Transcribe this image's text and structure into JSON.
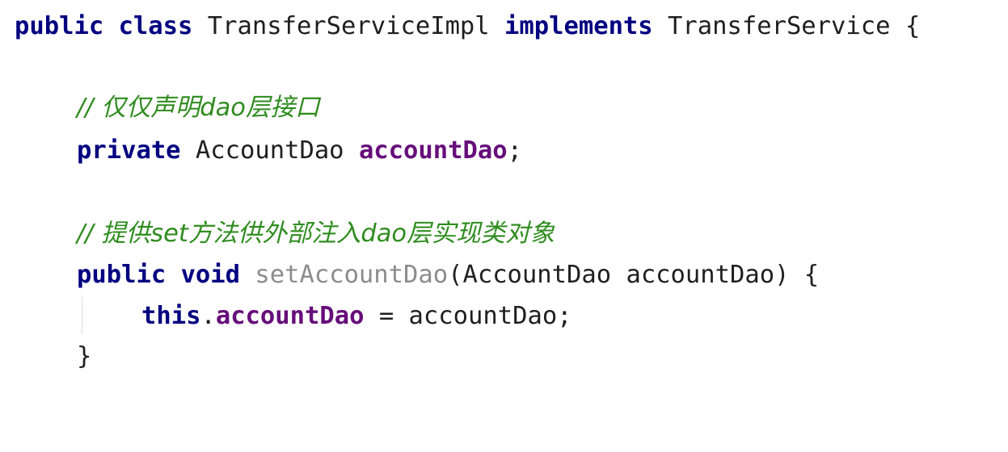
{
  "class_decl": {
    "kw_public": "public",
    "kw_class": "class",
    "class_name": "TransferServiceImpl",
    "kw_implements": "implements",
    "interface_name": "TransferService",
    "open_brace": "{"
  },
  "comment1": {
    "prefix": "// ",
    "text": "仅仅声明dao层接口"
  },
  "field_decl": {
    "kw_private": "private",
    "type": "AccountDao",
    "name": "accountDao",
    "semicolon": ";"
  },
  "comment2": {
    "prefix": "// ",
    "text": "提供set方法供外部注入dao层实现类对象"
  },
  "method_decl": {
    "kw_public": "public",
    "kw_void": "void",
    "name": "setAccountDao",
    "params": "(AccountDao accountDao) {"
  },
  "assign": {
    "kw_this": "this",
    "dot": ".",
    "field": "accountDao",
    "rest": " = accountDao;"
  },
  "close_method": "}"
}
